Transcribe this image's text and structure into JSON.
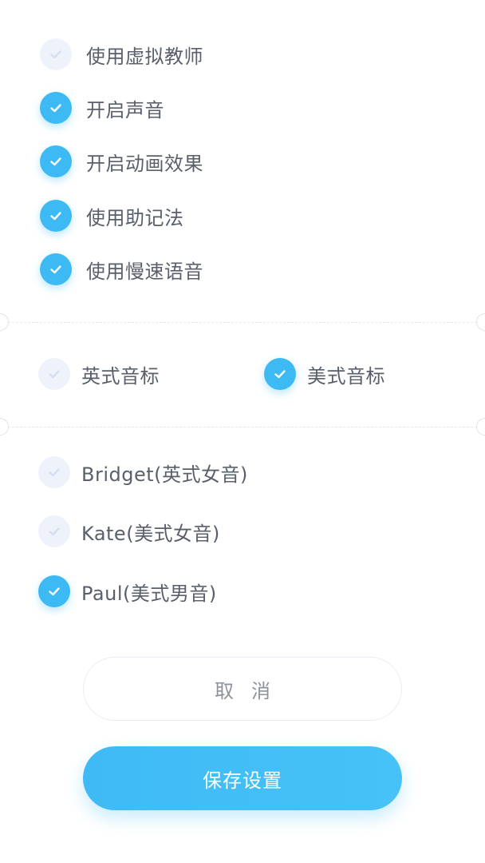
{
  "settings": {
    "options": [
      {
        "label": "使用虚拟教师",
        "checked": false
      },
      {
        "label": "开启声音",
        "checked": true
      },
      {
        "label": "开启动画效果",
        "checked": true
      },
      {
        "label": "使用助记法",
        "checked": true
      },
      {
        "label": "使用慢速语音",
        "checked": true
      }
    ]
  },
  "phonetic": {
    "options": [
      {
        "label": "英式音标",
        "checked": false
      },
      {
        "label": "美式音标",
        "checked": true
      }
    ]
  },
  "voice": {
    "options": [
      {
        "label": "Bridget(英式女音)",
        "checked": false
      },
      {
        "label": "Kate(美式女音)",
        "checked": false
      },
      {
        "label": "Paul(美式男音)",
        "checked": true
      }
    ]
  },
  "actions": {
    "cancel_label": "取消",
    "save_label": "保存设置"
  },
  "colors": {
    "accent": "#3dbaf4",
    "unchecked": "#eef2fb",
    "text": "#59606b"
  },
  "icons": {
    "check": "checkmark-icon"
  }
}
